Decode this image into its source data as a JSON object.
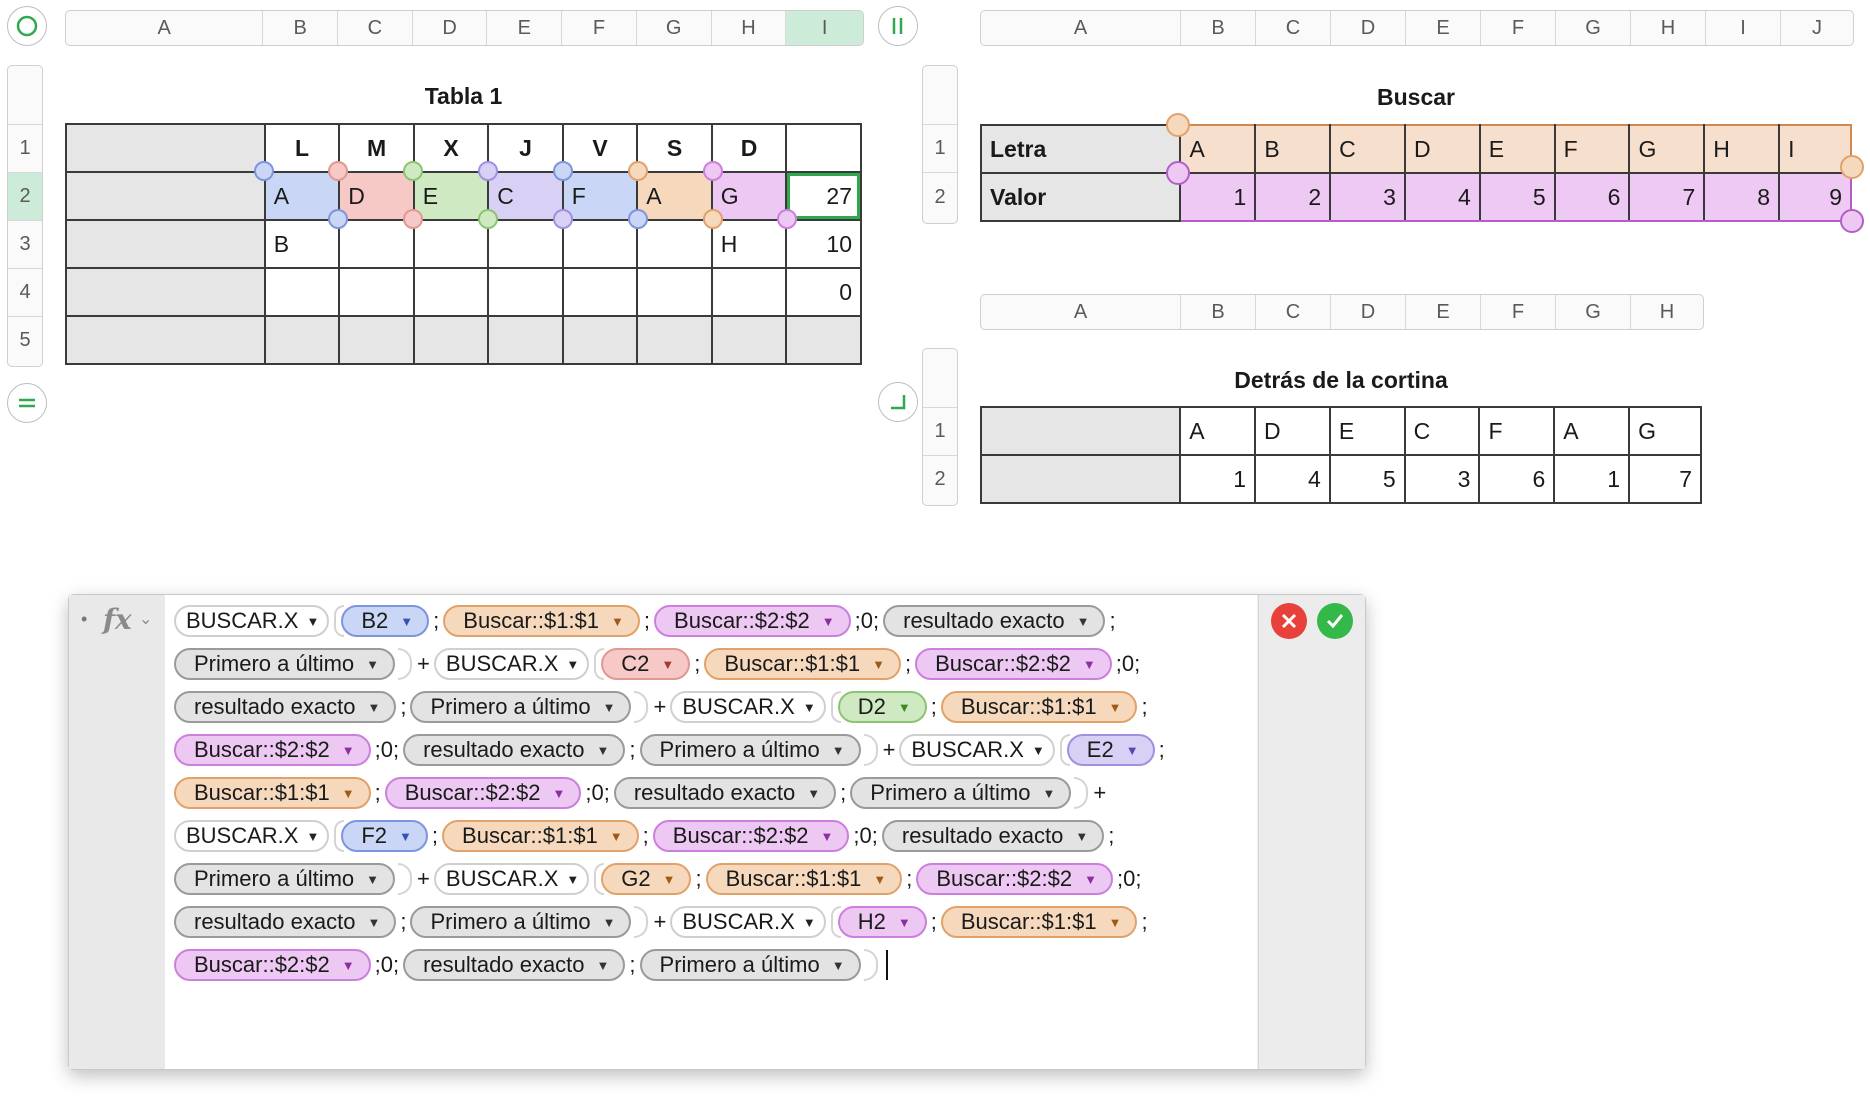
{
  "tabla1": {
    "title": "Tabla 1",
    "columns": [
      "A",
      "B",
      "C",
      "D",
      "E",
      "F",
      "G",
      "H",
      "I"
    ],
    "rows": [
      "1",
      "2",
      "3",
      "4",
      "5"
    ],
    "header_row": [
      "",
      "L",
      "M",
      "X",
      "J",
      "V",
      "S",
      "D",
      ""
    ],
    "row2": [
      "",
      "A",
      "D",
      "E",
      "C",
      "F",
      "A",
      "G",
      "27"
    ],
    "row3": [
      "",
      "B",
      "",
      "",
      "",
      "",
      "",
      "H",
      "10"
    ],
    "row4": [
      "",
      "",
      "",
      "",
      "",
      "",
      "",
      "",
      "0"
    ],
    "row5": [
      "",
      "",
      "",
      "",
      "",
      "",
      "",
      "",
      ""
    ],
    "selected_column": "I",
    "selected_row": "2"
  },
  "buscar": {
    "title": "Buscar",
    "columns": [
      "A",
      "B",
      "C",
      "D",
      "E",
      "F",
      "G",
      "H",
      "I",
      "J"
    ],
    "rows": [
      "1",
      "2"
    ],
    "row1_label": "Letra",
    "row2_label": "Valor",
    "letters": [
      "A",
      "B",
      "C",
      "D",
      "E",
      "F",
      "G",
      "H",
      "I"
    ],
    "values": [
      "1",
      "2",
      "3",
      "4",
      "5",
      "6",
      "7",
      "8",
      "9"
    ]
  },
  "cortina": {
    "title": "Detrás de la cortina",
    "columns": [
      "A",
      "B",
      "C",
      "D",
      "E",
      "F",
      "G",
      "H"
    ],
    "rows": [
      "1",
      "2"
    ],
    "letters": [
      "A",
      "D",
      "E",
      "C",
      "F",
      "A",
      "G"
    ],
    "values": [
      "1",
      "4",
      "5",
      "3",
      "6",
      "1",
      "7"
    ]
  },
  "formula": {
    "fx_label": "fx",
    "lines": [
      [
        {
          "t": "fn",
          "v": "BUSCAR.X"
        },
        {
          "t": "blue",
          "v": "B2"
        },
        {
          "t": "s",
          "v": ";"
        },
        {
          "t": "orange",
          "v": "Buscar::$1:$1"
        },
        {
          "t": "s",
          "v": ";"
        },
        {
          "t": "purple",
          "v": "Buscar::$2:$2"
        },
        {
          "t": "s",
          "v": ";0;"
        },
        {
          "t": "grey",
          "v": "resultado exacto"
        },
        {
          "t": "s",
          "v": ";"
        }
      ],
      [
        {
          "t": "grey",
          "v": "Primero a último"
        },
        {
          "t": "cap"
        },
        {
          "t": "s",
          "v": "+"
        },
        {
          "t": "fn",
          "v": "BUSCAR.X"
        },
        {
          "t": "red",
          "v": "C2"
        },
        {
          "t": "s",
          "v": ";"
        },
        {
          "t": "orange",
          "v": "Buscar::$1:$1"
        },
        {
          "t": "s",
          "v": ";"
        },
        {
          "t": "purple",
          "v": "Buscar::$2:$2"
        },
        {
          "t": "s",
          "v": ";0;"
        }
      ],
      [
        {
          "t": "grey",
          "v": "resultado exacto"
        },
        {
          "t": "s",
          "v": ";"
        },
        {
          "t": "grey",
          "v": "Primero a último"
        },
        {
          "t": "cap"
        },
        {
          "t": "s",
          "v": "+"
        },
        {
          "t": "fn",
          "v": "BUSCAR.X"
        },
        {
          "t": "green",
          "v": "D2"
        },
        {
          "t": "s",
          "v": ";"
        },
        {
          "t": "orange",
          "v": "Buscar::$1:$1"
        },
        {
          "t": "s",
          "v": ";"
        }
      ],
      [
        {
          "t": "purple",
          "v": "Buscar::$2:$2"
        },
        {
          "t": "s",
          "v": ";0;"
        },
        {
          "t": "grey",
          "v": "resultado exacto"
        },
        {
          "t": "s",
          "v": ";"
        },
        {
          "t": "grey",
          "v": "Primero a último"
        },
        {
          "t": "cap"
        },
        {
          "t": "s",
          "v": "+"
        },
        {
          "t": "fn",
          "v": "BUSCAR.X"
        },
        {
          "t": "violet",
          "v": "E2"
        },
        {
          "t": "s",
          "v": ";"
        }
      ],
      [
        {
          "t": "orange",
          "v": "Buscar::$1:$1"
        },
        {
          "t": "s",
          "v": ";"
        },
        {
          "t": "purple",
          "v": "Buscar::$2:$2"
        },
        {
          "t": "s",
          "v": ";0;"
        },
        {
          "t": "grey",
          "v": "resultado exacto"
        },
        {
          "t": "s",
          "v": ";"
        },
        {
          "t": "grey",
          "v": "Primero a último"
        },
        {
          "t": "cap"
        },
        {
          "t": "s",
          "v": "+"
        }
      ],
      [
        {
          "t": "fn",
          "v": "BUSCAR.X"
        },
        {
          "t": "blue",
          "v": "F2"
        },
        {
          "t": "s",
          "v": ";"
        },
        {
          "t": "orange",
          "v": "Buscar::$1:$1"
        },
        {
          "t": "s",
          "v": ";"
        },
        {
          "t": "purple",
          "v": "Buscar::$2:$2"
        },
        {
          "t": "s",
          "v": ";0;"
        },
        {
          "t": "grey",
          "v": "resultado exacto"
        },
        {
          "t": "s",
          "v": ";"
        }
      ],
      [
        {
          "t": "grey",
          "v": "Primero a último"
        },
        {
          "t": "cap"
        },
        {
          "t": "s",
          "v": "+"
        },
        {
          "t": "fn",
          "v": "BUSCAR.X"
        },
        {
          "t": "orange",
          "v": "G2"
        },
        {
          "t": "s",
          "v": ";"
        },
        {
          "t": "orange",
          "v": "Buscar::$1:$1"
        },
        {
          "t": "s",
          "v": ";"
        },
        {
          "t": "purple",
          "v": "Buscar::$2:$2"
        },
        {
          "t": "s",
          "v": ";0;"
        }
      ],
      [
        {
          "t": "grey",
          "v": "resultado exacto"
        },
        {
          "t": "s",
          "v": ";"
        },
        {
          "t": "grey",
          "v": "Primero a último"
        },
        {
          "t": "cap"
        },
        {
          "t": "s",
          "v": "+"
        },
        {
          "t": "fn",
          "v": "BUSCAR.X"
        },
        {
          "t": "purple",
          "v": "H2"
        },
        {
          "t": "s",
          "v": ";"
        },
        {
          "t": "orange",
          "v": "Buscar::$1:$1"
        },
        {
          "t": "s",
          "v": ";"
        }
      ],
      [
        {
          "t": "purple",
          "v": "Buscar::$2:$2"
        },
        {
          "t": "s",
          "v": ";0;"
        },
        {
          "t": "grey",
          "v": "resultado exacto"
        },
        {
          "t": "s",
          "v": ";"
        },
        {
          "t": "grey",
          "v": "Primero a último"
        },
        {
          "t": "cap"
        }
      ]
    ]
  },
  "colors": {
    "selection_green": "#cdebd9",
    "ref_blue": "#c9d6f5",
    "ref_red": "#f6c8c6",
    "ref_green": "#cfeac2",
    "ref_violet": "#d9d0f5",
    "ref_orange": "#f6d9bd",
    "ref_purple": "#ecc8f2",
    "cancel_red": "#e8403a",
    "accept_green": "#35b84a"
  }
}
